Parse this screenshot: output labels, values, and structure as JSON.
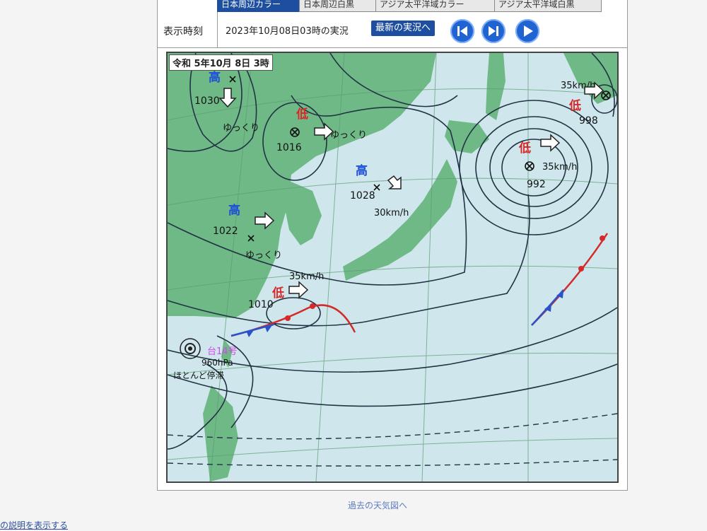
{
  "tabs": [
    {
      "label": "日本周辺カラー",
      "active": true
    },
    {
      "label": "日本周辺白黒",
      "active": false
    },
    {
      "label": "アジア太平洋域カラー",
      "active": false
    },
    {
      "label": "アジア太平洋域白黒",
      "active": false
    }
  ],
  "time_row": {
    "label": "表示時刻",
    "timestamp": "2023年10月08日03時の実況",
    "latest_button": "最新の実況へ"
  },
  "map": {
    "date_label": "令和 5年10月 8日 3時",
    "highs": [
      {
        "symbol": "高",
        "pressure": "1030"
      },
      {
        "symbol": "高",
        "pressure": "1028",
        "speed": "30km/h"
      },
      {
        "symbol": "高",
        "pressure": "1022"
      }
    ],
    "lows": [
      {
        "symbol": "低",
        "pressure": "1016"
      },
      {
        "symbol": "低",
        "pressure": "1010",
        "speed": "35km/h"
      },
      {
        "symbol": "低",
        "pressure": "992",
        "speed": "35km/h"
      },
      {
        "symbol": "低",
        "pressure": "998",
        "speed": "35km/h"
      }
    ],
    "slow_label": "ゆっくり",
    "typhoon": {
      "name": "台14号",
      "pressure": "960hPa",
      "remark": "ほとんど停滞"
    }
  },
  "footer": {
    "past_maps_link": "過去の天気図へ",
    "description_link": "の説明を表示する"
  },
  "colors": {
    "accent": "#1d4e9f",
    "nav": "#1f64d0",
    "land": "#6fb987",
    "sea": "#cfe7ec",
    "high": "#1d4ed8",
    "low": "#dc2626"
  }
}
